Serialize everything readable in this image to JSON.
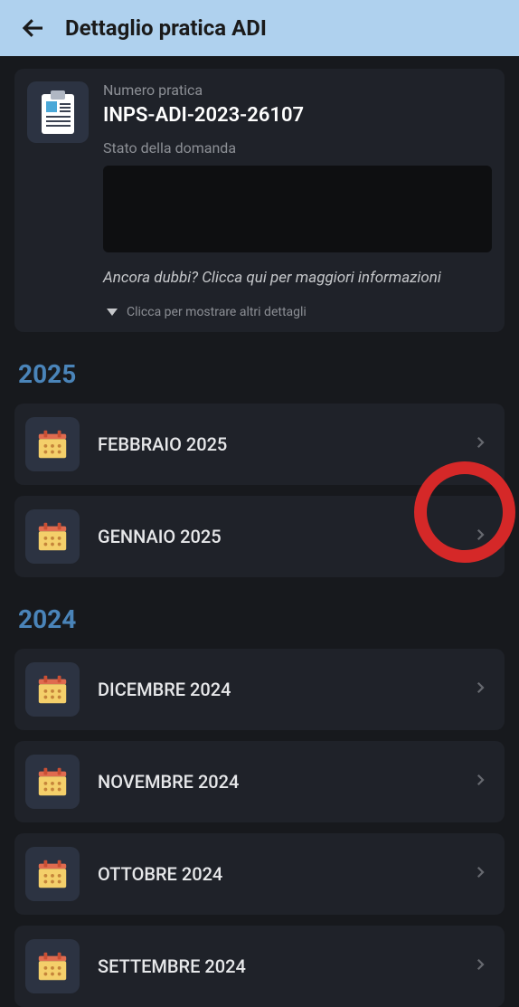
{
  "header": {
    "title": "Dettaglio pratica ADI"
  },
  "practice": {
    "number_label": "Numero pratica",
    "number_value": "INPS-ADI-2023-26107",
    "status_label": "Stato della domanda",
    "more_info": "Ancora dubbi? Clicca qui per maggiori informazioni",
    "expand_label": "Clicca per mostrare altri dettagli"
  },
  "years": [
    {
      "label": "2025",
      "months": [
        {
          "label": "FEBBRAIO 2025"
        },
        {
          "label": "GENNAIO 2025"
        }
      ]
    },
    {
      "label": "2024",
      "months": [
        {
          "label": "DICEMBRE 2024"
        },
        {
          "label": "NOVEMBRE 2024"
        },
        {
          "label": "OTTOBRE 2024"
        },
        {
          "label": "SETTEMBRE 2024"
        }
      ]
    }
  ]
}
